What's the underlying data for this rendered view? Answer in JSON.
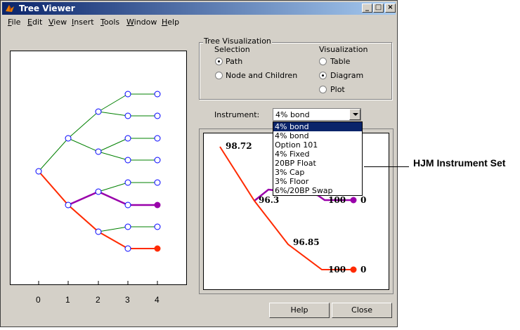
{
  "window": {
    "title": "Tree Viewer",
    "buttons": {
      "minimize": "_",
      "maximize": "□",
      "close": "×"
    }
  },
  "menu": [
    "File",
    "Edit",
    "View",
    "Insert",
    "Tools",
    "Window",
    "Help"
  ],
  "tree_plot": {
    "x_ticks": [
      "0",
      "1",
      "2",
      "3",
      "4"
    ],
    "colors": {
      "node": "#0000ff",
      "branch": "#008000",
      "path": "#ff2a00",
      "secondary_path": "#9900aa"
    }
  },
  "visualization_group": {
    "title": "Tree Visualization",
    "selection_label": "Selection",
    "selection_options": [
      {
        "label": "Path",
        "checked": true
      },
      {
        "label": "Node and Children",
        "checked": false
      }
    ],
    "visualization_label": "Visualization",
    "visualization_options": [
      {
        "label": "Table",
        "checked": false
      },
      {
        "label": "Diagram",
        "checked": true
      },
      {
        "label": "Plot",
        "checked": false
      }
    ]
  },
  "instrument": {
    "label": "Instrument:",
    "selected": "4% bond",
    "options": [
      "4% bond",
      "4% bond",
      "Option 101",
      "4% Fixed",
      "20BP Float",
      "3% Cap",
      "3% Floor",
      "6%/20BP Swap"
    ]
  },
  "diagram": {
    "values": [
      "98.72",
      "96.3",
      "96.85",
      "100",
      "0",
      "100",
      "0"
    ]
  },
  "buttons": {
    "help": "Help",
    "close": "Close"
  },
  "annotation": "HJM Instrument Set"
}
